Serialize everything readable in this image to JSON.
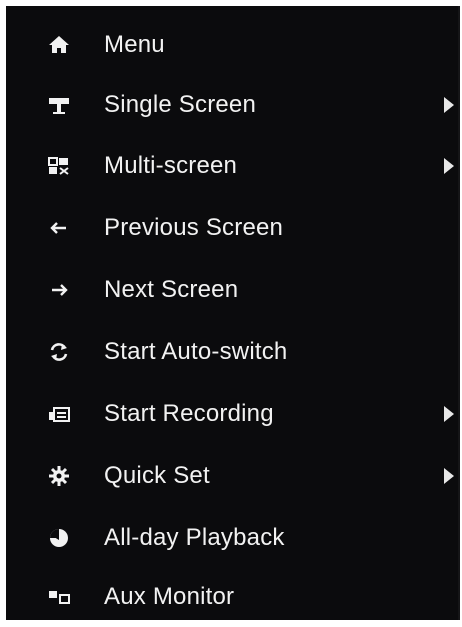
{
  "menu": {
    "items": [
      {
        "label": "Menu",
        "icon": "home-icon",
        "has_submenu": false
      },
      {
        "label": "Single Screen",
        "icon": "single-screen-icon",
        "has_submenu": true
      },
      {
        "label": "Multi-screen",
        "icon": "multi-screen-icon",
        "has_submenu": true
      },
      {
        "label": "Previous Screen",
        "icon": "arrow-left-icon",
        "has_submenu": false
      },
      {
        "label": "Next Screen",
        "icon": "arrow-right-icon",
        "has_submenu": false
      },
      {
        "label": "Start Auto-switch",
        "icon": "refresh-icon",
        "has_submenu": false
      },
      {
        "label": "Start Recording",
        "icon": "record-icon",
        "has_submenu": true
      },
      {
        "label": "Quick Set",
        "icon": "gear-icon",
        "has_submenu": true
      },
      {
        "label": "All-day Playback",
        "icon": "playback-icon",
        "has_submenu": false
      },
      {
        "label": "Aux Monitor",
        "icon": "aux-monitor-icon",
        "has_submenu": false
      }
    ]
  },
  "colors": {
    "background": "#0b0b0d",
    "text": "#f2f2f2"
  }
}
